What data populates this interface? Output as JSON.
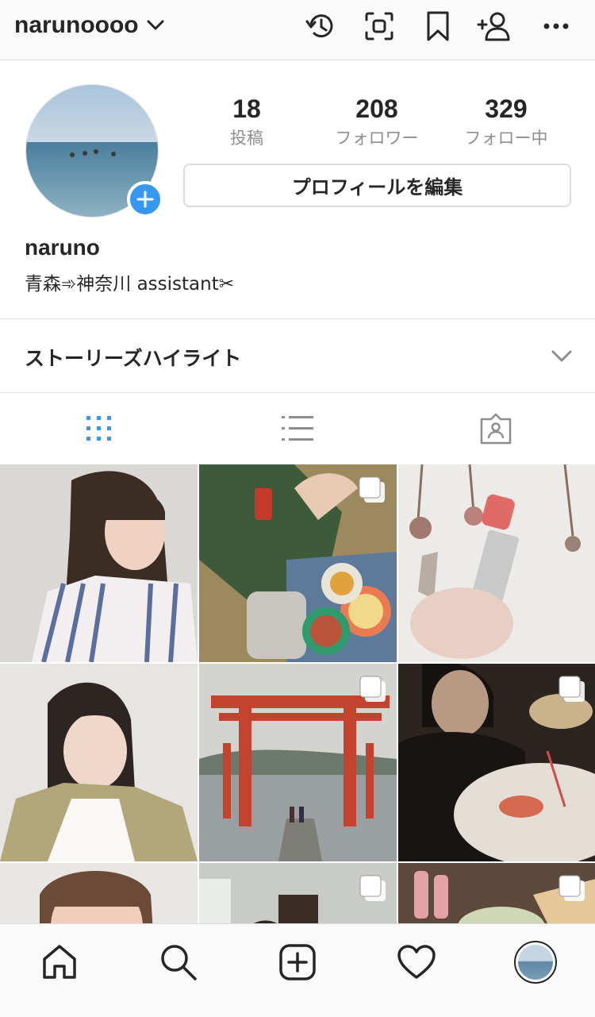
{
  "header": {
    "username": "narunoooo",
    "icons": [
      "chevron-down-icon",
      "history-icon",
      "qr-scan-icon",
      "bookmark-icon",
      "add-person-icon",
      "more-icon"
    ]
  },
  "profile": {
    "stats": [
      {
        "value": "18",
        "label": "投稿"
      },
      {
        "value": "208",
        "label": "フォロワー"
      },
      {
        "value": "329",
        "label": "フォロー中"
      }
    ],
    "edit_button": "プロフィールを編集",
    "display_name": "naruno",
    "bio": "青森➾神奈川 assistant✂︎"
  },
  "highlights": {
    "title": "ストーリーズハイライト"
  },
  "tabs": [
    "grid-icon",
    "list-icon",
    "tagged-icon"
  ],
  "grid": {
    "posts": [
      {
        "multi": false
      },
      {
        "multi": true
      },
      {
        "multi": false
      },
      {
        "multi": false
      },
      {
        "multi": true
      },
      {
        "multi": true
      },
      {
        "multi": false
      },
      {
        "multi": true
      },
      {
        "multi": true
      }
    ]
  },
  "bottom_nav": [
    "home-icon",
    "search-icon",
    "add-post-icon",
    "activity-heart-icon",
    "profile-avatar"
  ],
  "colors": {
    "accent": "#3897f0",
    "border": "#dbdbdb",
    "text": "#262626",
    "muted": "#8e8e8e"
  }
}
